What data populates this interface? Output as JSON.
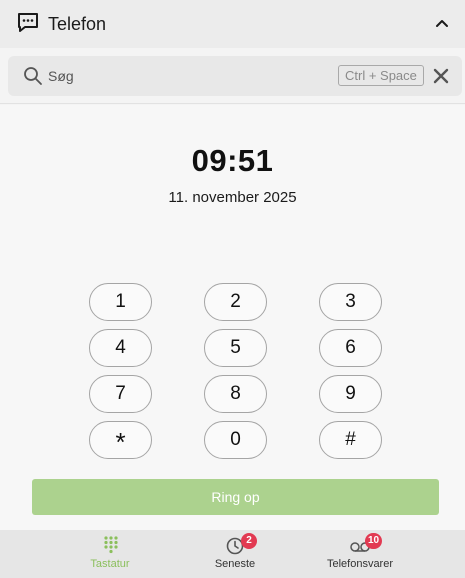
{
  "header": {
    "title": "Telefon",
    "app_icon": "chat-bubble-icon",
    "collapse_icon": "chevron-up-icon"
  },
  "search": {
    "placeholder": "Søg",
    "value": "",
    "shortcut": "Ctrl + Space",
    "icon": "search-icon",
    "clear_icon": "close-icon"
  },
  "clock": {
    "time": "09:51",
    "date": "11. november 2025"
  },
  "keypad": {
    "keys": [
      "1",
      "2",
      "3",
      "4",
      "5",
      "6",
      "7",
      "8",
      "9",
      "*",
      "0",
      "#"
    ]
  },
  "call_button": {
    "label": "Ring op",
    "color": "#acd28e"
  },
  "bottom_nav": {
    "items": [
      {
        "label": "Tastatur",
        "icon": "dialpad-icon",
        "active": true,
        "badge": ""
      },
      {
        "label": "Seneste",
        "icon": "clock-icon",
        "active": false,
        "badge": "2"
      },
      {
        "label": "Telefonsvarer",
        "icon": "voicemail-icon",
        "active": false,
        "badge": "10"
      }
    ],
    "accent": "#8bbf5c",
    "badge_color": "#e23a52"
  }
}
